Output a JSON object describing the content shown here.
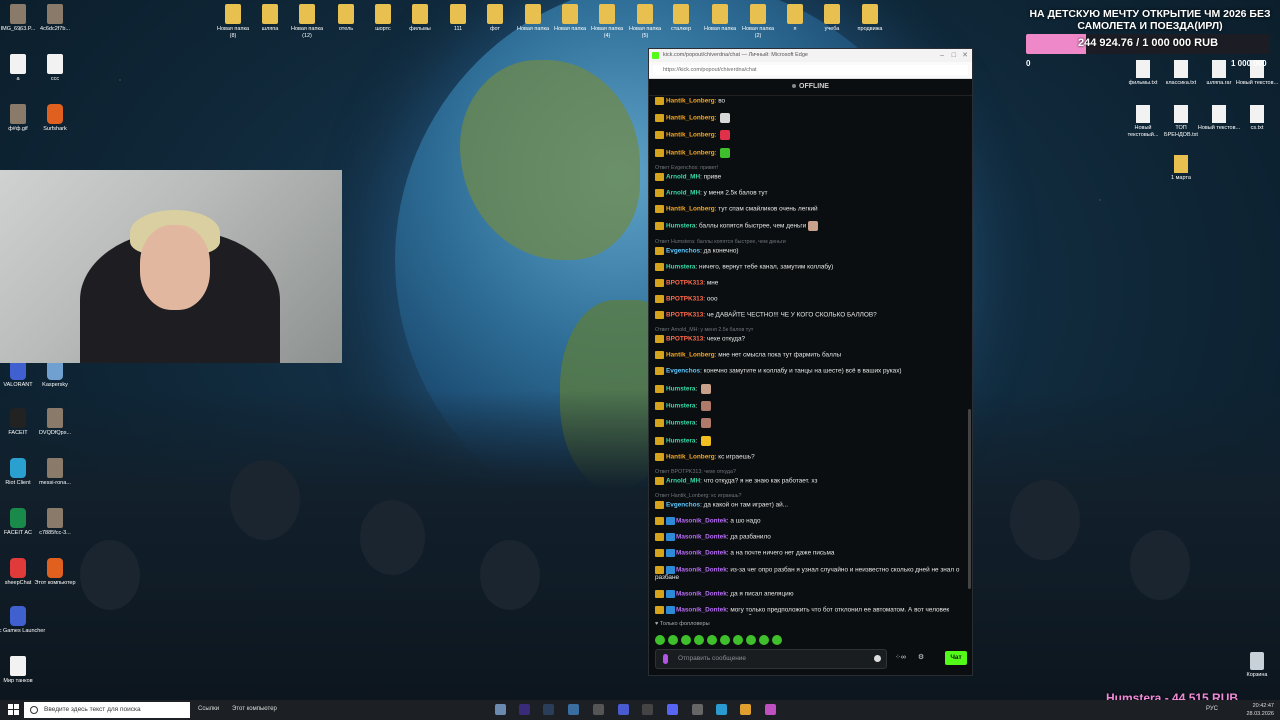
{
  "colors": {
    "kick_green": "#53fc18",
    "goal_fill": "#ee88c8",
    "badge": "#d6a31d"
  },
  "desktop_left": [
    {
      "label": "IMG_6963.P...",
      "kind": "img"
    },
    {
      "label": "4c6dc2f7b...",
      "kind": "img"
    },
    {
      "label": "а",
      "kind": "file"
    },
    {
      "label": "ссс",
      "kind": "file"
    },
    {
      "label": "ф#ф.gif",
      "kind": "img"
    },
    {
      "label": "Surfshark",
      "kind": "app"
    },
    {
      "label": "VALORANT",
      "kind": "app"
    },
    {
      "label": "Kaspersky",
      "kind": "app"
    },
    {
      "label": "FACEIT",
      "kind": "app"
    },
    {
      "label": "DVQDfQps...",
      "kind": "img"
    },
    {
      "label": "Riot Client",
      "kind": "app"
    },
    {
      "label": "messi-rona...",
      "kind": "img"
    },
    {
      "label": "FACEIT AC",
      "kind": "app"
    },
    {
      "label": "c7885fcc-3...",
      "kind": "img"
    },
    {
      "label": "sheepChat",
      "kind": "app"
    },
    {
      "label": "Этот компьютер",
      "kind": "app"
    },
    {
      "label": "Epic Games Launcher",
      "kind": "app"
    },
    {
      "label": "Мир танков",
      "kind": "file"
    }
  ],
  "desktop_top": [
    {
      "label": "Новая папка (8)"
    },
    {
      "label": "шляпа"
    },
    {
      "label": "Новая папка (12)"
    },
    {
      "label": "отель"
    },
    {
      "label": "шортс"
    },
    {
      "label": "фильмы"
    },
    {
      "label": "111"
    },
    {
      "label": "фот"
    },
    {
      "label": "Новая папка"
    },
    {
      "label": "Новая папка"
    },
    {
      "label": "Новая папка (4)"
    },
    {
      "label": "Новая папка (5)"
    },
    {
      "label": "сталкер"
    },
    {
      "label": "Новая папка"
    },
    {
      "label": "Новая папка (2)"
    },
    {
      "label": "я"
    },
    {
      "label": "учеба"
    },
    {
      "label": "продвижа"
    }
  ],
  "desktop_right": [
    {
      "label": "фильмы.txt"
    },
    {
      "label": "классика.txt"
    },
    {
      "label": "шляпа.rar"
    },
    {
      "label": "Новый текстов..."
    },
    {
      "label": "Новый текстовый..."
    },
    {
      "label": "ТОП БРЕНДОВ.txt"
    },
    {
      "label": "Новый текстов..."
    },
    {
      "label": "cs.txt"
    },
    {
      "label": "1 марта"
    },
    {
      "label": "Корзина"
    }
  ],
  "goal": {
    "title": "НА ДЕТСКУЮ МЕЧТУ ОТКРЫТИЕ ЧМ 2026 БЕЗ САМОЛЕТА И ПОЕЗДА(ИРЛ)",
    "current_text": "244 924.76 / 1 000 000 RUB",
    "progress": 0.245,
    "min": "0",
    "max": "1 000 000"
  },
  "browser": {
    "title": "kick.com/popout/chiverdna/chat — Личный: Microsoft Edge",
    "url": "https://kick.com/popout/chiverdna/chat",
    "status": "OFFLINE"
  },
  "chat": {
    "messages": [
      {
        "reply": "",
        "user": "Hantik_Lonberg",
        "color": "#f5a623",
        "text": "во"
      },
      {
        "reply": "",
        "user": "Hantik_Lonberg",
        "color": "#f5a623",
        "text": "",
        "emote": "#d8d8d8"
      },
      {
        "reply": "",
        "user": "Hantik_Lonberg",
        "color": "#f5a623",
        "text": "",
        "emote": "#e0304a"
      },
      {
        "reply": "",
        "user": "Hantik_Lonberg",
        "color": "#f5a623",
        "text": "",
        "emote": "#3fbf2b"
      },
      {
        "reply": "Ответ Evgenchos: привет!",
        "user": "Arnold_MH",
        "color": "#38d9a9",
        "text": "приве"
      },
      {
        "reply": "",
        "user": "Arnold_MH",
        "color": "#38d9a9",
        "text": "у меня 2.5к балов тут"
      },
      {
        "reply": "",
        "user": "Hantik_Lonberg",
        "color": "#f5a623",
        "text": "тут спам смайликов очень легкий"
      },
      {
        "reply": "",
        "user": "Humstera",
        "color": "#38d9a9",
        "text": "баллы копятся быстрее, чем деньги",
        "emote": "#c9a08a"
      },
      {
        "reply": "Ответ Humstera: баллы копятся быстрее, чем деньги",
        "user": "Evgenchos",
        "color": "#5ec8ff",
        "text": "да конечно)"
      },
      {
        "reply": "",
        "user": "Humstera",
        "color": "#38d9a9",
        "text": "ничего, вернут тебе канал, замутим коллабу)"
      },
      {
        "reply": "",
        "user": "BPOTPK313",
        "color": "#ff6b4a",
        "text": "мне"
      },
      {
        "reply": "",
        "user": "BPOTPK313",
        "color": "#ff6b4a",
        "text": "ооо"
      },
      {
        "reply": "",
        "user": "BPOTPK313",
        "color": "#ff6b4a",
        "text": "че ДАВАЙТЕ ЧЕСТНО!!! ЧЕ У КОГО СКОЛЬКО БАЛЛОВ?"
      },
      {
        "reply": "Ответ Arnold_MH: у меня 2.5к балов тут",
        "user": "BPOTPK313",
        "color": "#ff6b4a",
        "text": "чехе откуда?"
      },
      {
        "reply": "",
        "user": "Hantik_Lonberg",
        "color": "#f5a623",
        "text": "мне нет смысла пока тут фармить баллы"
      },
      {
        "reply": "",
        "user": "Evgenchos",
        "color": "#5ec8ff",
        "text": "конечно замутите и коллабу и танцы на шесте) всё в ваших руках)"
      },
      {
        "reply": "",
        "user": "Humstera",
        "color": "#38d9a9",
        "text": "",
        "emote": "#c9a08a"
      },
      {
        "reply": "",
        "user": "Humstera",
        "color": "#38d9a9",
        "text": "",
        "emote": "#b07a6a"
      },
      {
        "reply": "",
        "user": "Humstera",
        "color": "#38d9a9",
        "text": "",
        "emote": "#b07a6a"
      },
      {
        "reply": "",
        "user": "Humstera",
        "color": "#38d9a9",
        "text": "",
        "emote": "#f0c020"
      },
      {
        "reply": "",
        "user": "Hantik_Lonberg",
        "color": "#f5a623",
        "text": "кс играешь?"
      },
      {
        "reply": "Ответ BPOTPK313: чехе откуда?",
        "user": "Arnold_MH",
        "color": "#38d9a9",
        "text": "что откуда? я не знаю как работает. хз"
      },
      {
        "reply": "Ответ Hantik_Lonberg: кс играешь?",
        "user": "Evgenchos",
        "color": "#5ec8ff",
        "text": "да какой он там играет) ай..."
      },
      {
        "reply": "",
        "user": "Masonik_Dontek",
        "color": "#b66cf5",
        "text": "а шо надо",
        "badge2": true
      },
      {
        "reply": "",
        "user": "Masonik_Dontek",
        "color": "#b66cf5",
        "text": "да разбанило",
        "badge2": true
      },
      {
        "reply": "",
        "user": "Masonik_Dontek",
        "color": "#b66cf5",
        "text": "а на почте ничего нет даже письма",
        "badge2": true
      },
      {
        "reply": "",
        "user": "Masonik_Dontek",
        "color": "#b66cf5",
        "text": "из-за чег опро разбан я узнал случайно и неизвестно сколько дней не знал о разбане",
        "badge2": true
      },
      {
        "reply": "",
        "user": "Masonik_Dontek",
        "color": "#b66cf5",
        "text": "да я писал апеляцию",
        "badge2": true
      },
      {
        "reply": "",
        "user": "Masonik_Dontek",
        "color": "#b66cf5",
        "text": "могу только предположить что бот отклонил ее автоматом. А вот человек перепроверил и понял что он обосрался",
        "badge2": true
      }
    ],
    "followers_only": "Только фолловеры",
    "input_placeholder": "Отправить сообщение",
    "send_label": "Чат"
  },
  "taskbar": {
    "search_placeholder": "Введите здесь текст для поиска",
    "links_label": "Ссылки",
    "computer_label": "Этот компьютер",
    "lang": "РУС",
    "time": "20:42:47",
    "date": "28.03.2026"
  },
  "sub_alert": "Humstera - 44 515 RUB"
}
